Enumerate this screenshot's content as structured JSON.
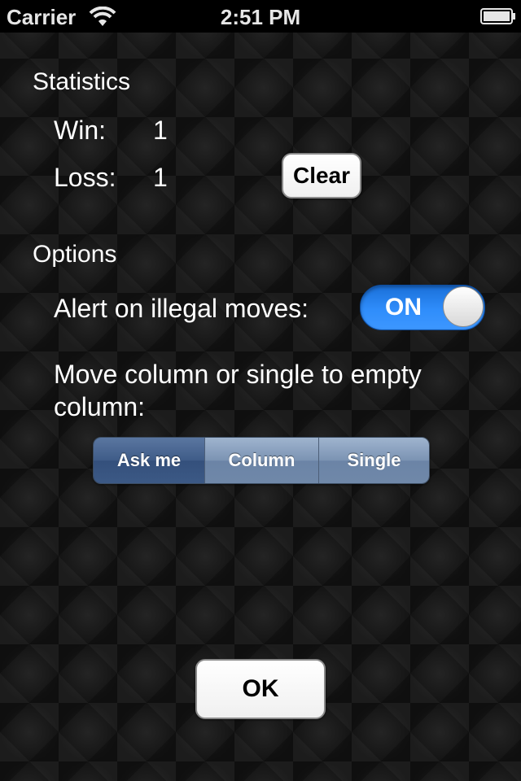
{
  "status_bar": {
    "carrier": "Carrier",
    "time": "2:51 PM",
    "icons": [
      "wifi-icon",
      "battery-icon"
    ]
  },
  "statistics": {
    "heading": "Statistics",
    "win_label": "Win:",
    "win_value": "1",
    "loss_label": "Loss:",
    "loss_value": "1",
    "clear_button": "Clear"
  },
  "options": {
    "heading": "Options",
    "alert_label": "Alert on illegal moves:",
    "alert_toggle": {
      "label": "ON",
      "on": true,
      "color": "#2f8dfb"
    },
    "move_label": "Move column or single to empty column:",
    "move_segments": [
      {
        "label": "Ask me",
        "selected": true
      },
      {
        "label": "Column",
        "selected": false
      },
      {
        "label": "Single",
        "selected": false
      }
    ]
  },
  "ok_button": "OK"
}
